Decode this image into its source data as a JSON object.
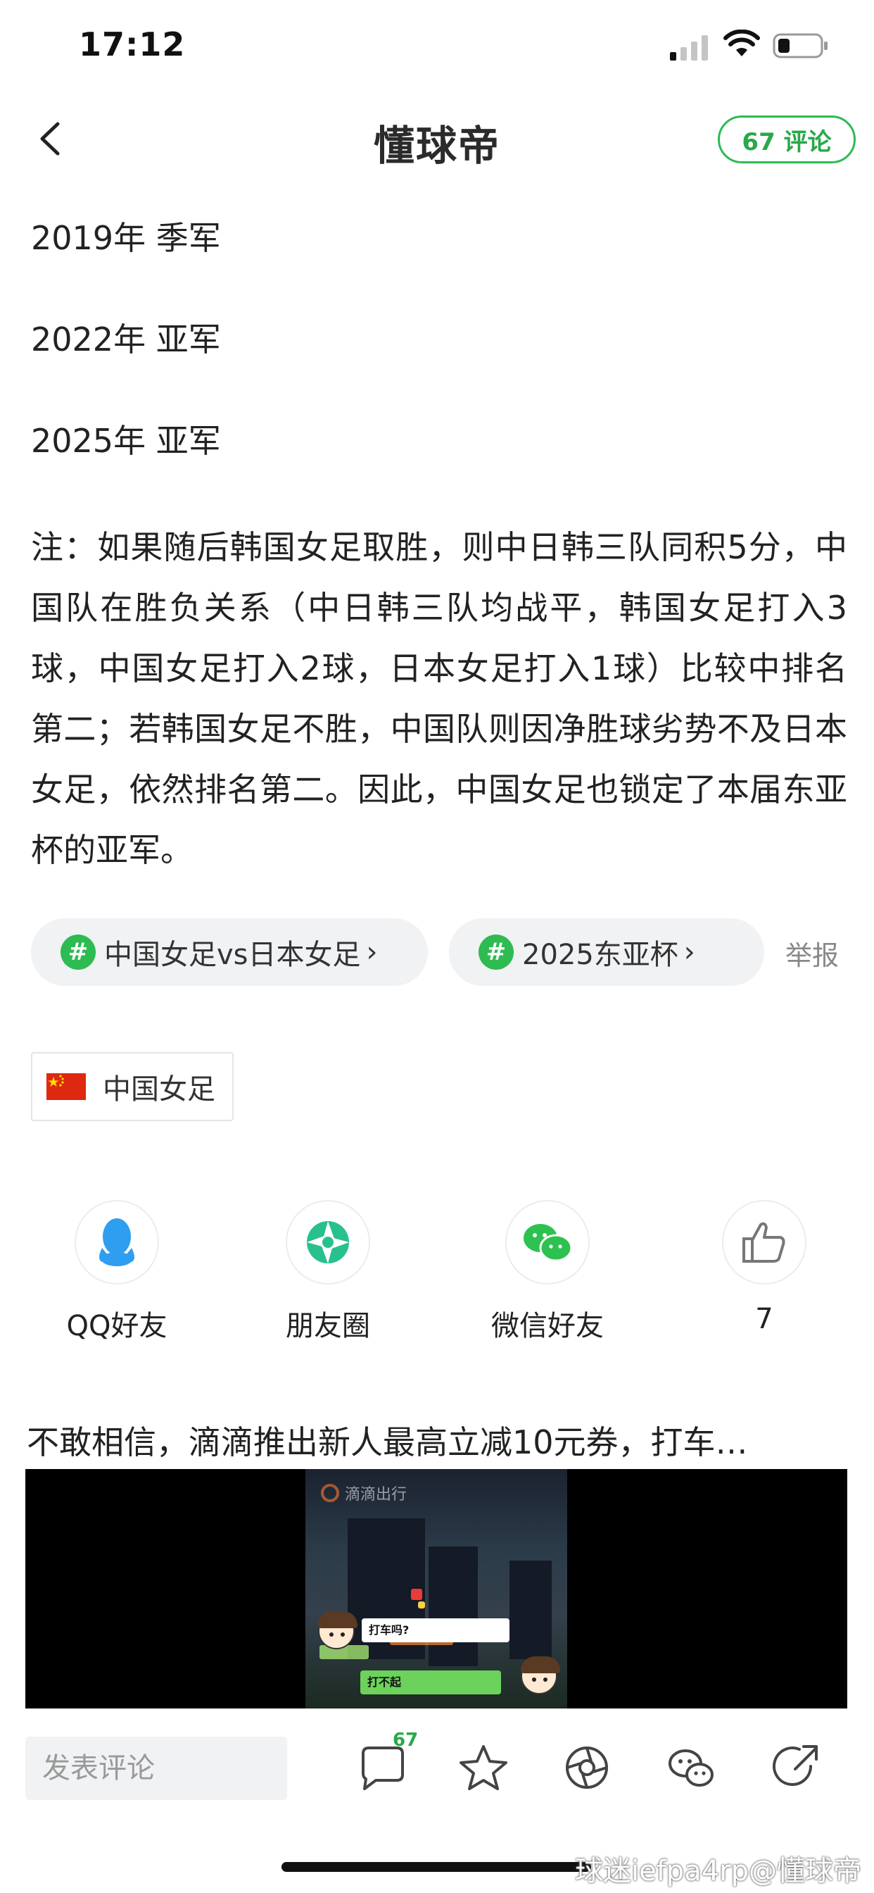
{
  "status_bar": {
    "time": "17:12"
  },
  "nav": {
    "title": "懂球帝",
    "comments_label": "67 评论"
  },
  "article": {
    "lines": [
      "2019年 季军",
      "2022年 亚军",
      "2025年 亚军"
    ],
    "note": "注：如果随后韩国女足取胜，则中日韩三队同积5分，中国队在胜负关系（中日韩三队均战平，韩国女足打入3球，中国女足打入2球，日本女足打入1球）比较中排名第二；若韩国女足不胜，中国队则因净胜球劣势不及日本女足，依然排名第二。因此，中国女足也锁定了本届东亚杯的亚军。"
  },
  "topics": [
    {
      "label": "中国女足vs日本女足"
    },
    {
      "label": "2025东亚杯"
    }
  ],
  "report_label": "举报",
  "team_tag": {
    "label": "中国女足"
  },
  "share": [
    {
      "label": "QQ好友",
      "icon": "qq-icon"
    },
    {
      "label": "朋友圈",
      "icon": "moments-icon"
    },
    {
      "label": "微信好友",
      "icon": "wechat-icon"
    },
    {
      "label": "7",
      "icon": "thumbs-up-icon"
    }
  ],
  "ad": {
    "title": "不敢相信，滴滴推出新人最高立减10元券，打车…",
    "brand": "滴滴出行",
    "bubble1": "打车吗?",
    "bubble2": "打不起"
  },
  "bottom_bar": {
    "comment_placeholder": "发表评论",
    "comment_count": "67"
  },
  "watermark": "球迷iefpa4rp@懂球帝",
  "colors": {
    "accent": "#2dbb52",
    "text": "#222222",
    "muted": "#888888"
  }
}
